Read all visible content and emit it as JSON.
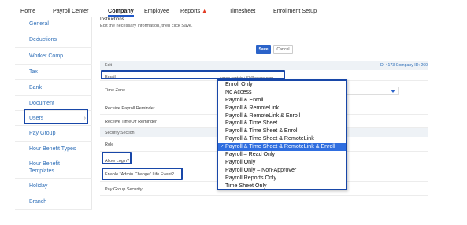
{
  "nav": {
    "items": [
      "Home",
      "Payroll Center",
      "Company",
      "Employee",
      "Reports",
      "Timesheet",
      "Enrollment Setup"
    ],
    "active": "Company",
    "warning_icon": "warning-triangle-icon",
    "warning_glyph": "▲"
  },
  "sidebar": {
    "items": [
      "General",
      "Deductions",
      "Worker Comp",
      "Tax",
      "Bank",
      "Document",
      "Users",
      "Pay Group",
      "Hour Benefit Types",
      "Hour Benefit Templates",
      "Holiday",
      "Branch"
    ],
    "selected": "Users",
    "selected_chevron": "›"
  },
  "main": {
    "instructions_title": "Instructions",
    "instructions_text": "Edit the necessary information, then click Save.",
    "save_label": "Save",
    "cancel_label": "Cancel",
    "edit_label": "Edit",
    "ids_text": "ID: 4173   Company ID: 260",
    "email_label": "Email",
    "email_value": "sarah.certain+37@asure.com",
    "timezone_label": "Time Zone",
    "receive_payroll_reminder_label": "Receive Payroll Reminder",
    "receive_timeoff_reminder_label": "Receive TimeOff Reminder",
    "security_section_label": "Security Section",
    "role_label": "Role",
    "allow_login_label": "Allow Login?",
    "admin_change_label": "Enable \"Admin Change\" Life Event?",
    "pay_group_security_label": "Pay Group Security"
  },
  "dropdown": {
    "options": [
      "Enroll Only",
      "No Access",
      "Payroll & Enroll",
      "Payroll & RemoteLink",
      "Payroll & RemoteLink & Enroll",
      "Payroll & Time Sheet",
      "Payroll & Time Sheet & Enroll",
      "Payroll & Time Sheet & RemoteLink",
      "Payroll & Time Sheet & RemoteLink & Enroll",
      "Payroll – Read Only",
      "Payroll Only",
      "Payroll Only – Non-Approver",
      "Payroll Reports Only",
      "Time Sheet Only"
    ],
    "selected_index": 8,
    "check_glyph": "✓"
  },
  "colors": {
    "accent": "#2b63c9",
    "highlight_border": "#1847a8",
    "selected_option": "#2f6ee0",
    "link": "#2f6fb8",
    "warning": "#e23b23"
  }
}
